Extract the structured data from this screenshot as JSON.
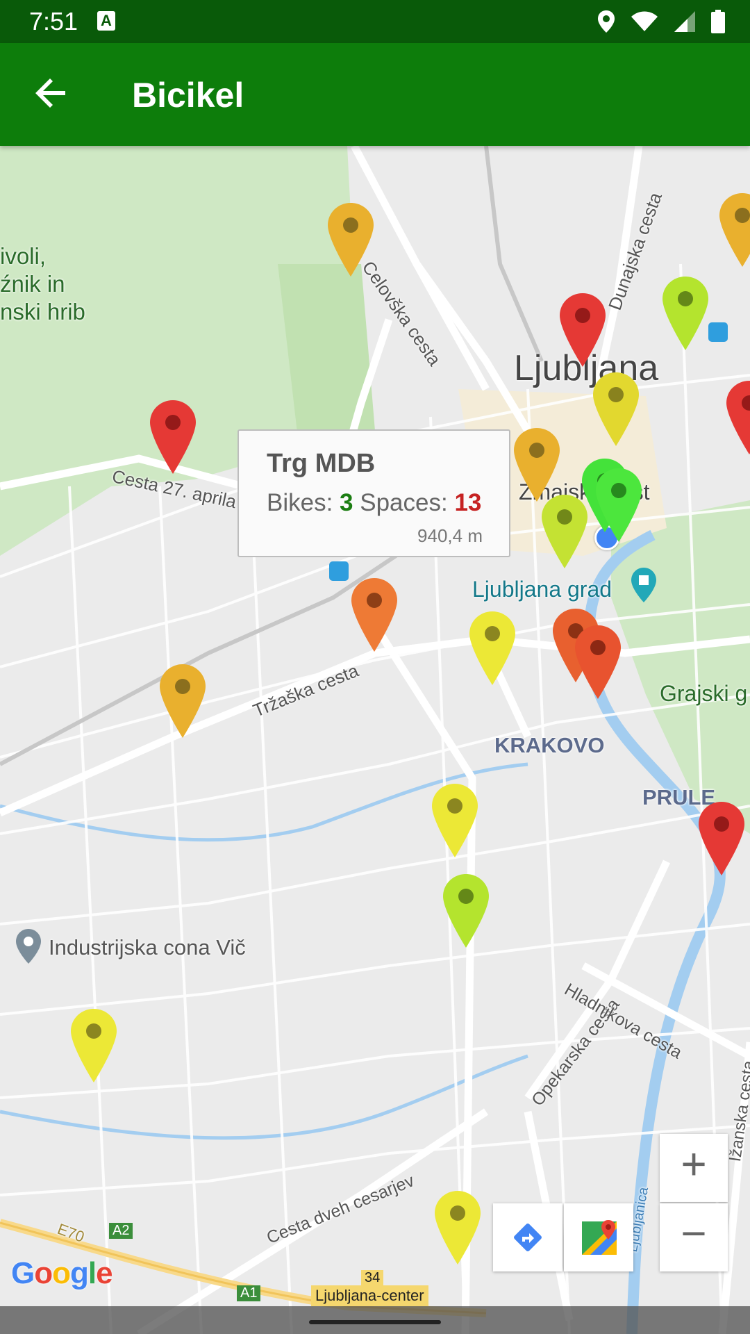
{
  "status": {
    "time": "7:51"
  },
  "app": {
    "title": "Bicikel"
  },
  "map": {
    "labels": {
      "tivoli_1": "ivoli,",
      "tivoli_2": "źnik in",
      "tivoli_3": "nski hrib",
      "ljubljana": "Ljubljana",
      "celovska": "Celovška cesta",
      "dunajska": "Dunajska cesta",
      "cesta27": "Cesta 27. aprila",
      "trzaska": "Tržaška cesta",
      "ljubljana_grad": "Ljubljana grad",
      "grajski": "Grajski g",
      "krakovo": "KRAKOVO",
      "prule": "PRULE",
      "industrijska": "Industrijska cona Vič",
      "opekarska": "Opekarska cesta",
      "hladnikova": "Hladnikova cesta",
      "cesta_dveh": "Cesta dveh cesarjev",
      "izanska": "Ižanska cesta",
      "ljubljanica": "Ljubljanica",
      "zmajski": "Zmajski most",
      "road_a2": "A2",
      "road_a1": "A1",
      "road_34": "34",
      "ljubljana_center": "Ljubljana-center",
      "e70": "E70"
    },
    "info_window": {
      "title": "Trg MDB",
      "bikes_label": "Bikes:",
      "bikes_value": "3",
      "spaces_label": "Spaces:",
      "spaces_value": "13",
      "distance": "940,4 m"
    },
    "marker_colors": {
      "red": "#e53935",
      "orange_red": "#e8602f",
      "orange": "#ee7a35",
      "amber": "#e9b02e",
      "yellow": "#ece836",
      "lime": "#b4e42e",
      "green": "#44e23a"
    },
    "zoom_in": "+",
    "zoom_out": "−",
    "google": "Google"
  }
}
